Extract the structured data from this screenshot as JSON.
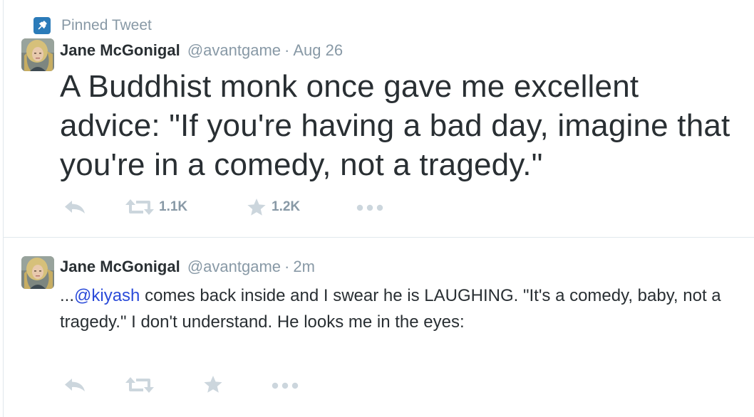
{
  "pinned_tweet": {
    "label": "Pinned Tweet",
    "author": {
      "name": "Jane McGonigal",
      "handle": "@avantgame"
    },
    "separator": "·",
    "timestamp": "Aug 26",
    "text": "A Buddhist monk once gave me excellent advice: \"If you're having a bad day, imagine that you're in a comedy, not a tragedy.\"",
    "actions": {
      "retweets": "1.1K",
      "favorites": "1.2K"
    }
  },
  "reply_tweet": {
    "author": {
      "name": "Jane McGonigal",
      "handle": "@avantgame"
    },
    "separator": "·",
    "timestamp": "2m",
    "text_prefix": "...",
    "mention": "@kiyash",
    "text_rest": " comes back inside and I swear he is LAUGHING. \"It's a comedy, baby, not a tragedy.\" I don't understand. He looks me in the eyes:"
  },
  "colors": {
    "icon_gray": "#ccd6dd",
    "muted_text": "#8899a6",
    "pin_blue": "#2b7bb9",
    "link_blue": "#2b4bd9",
    "divider": "#e1e8ed"
  },
  "icons": [
    "pin-icon",
    "reply-icon",
    "retweet-icon",
    "favorite-icon",
    "more-icon"
  ]
}
